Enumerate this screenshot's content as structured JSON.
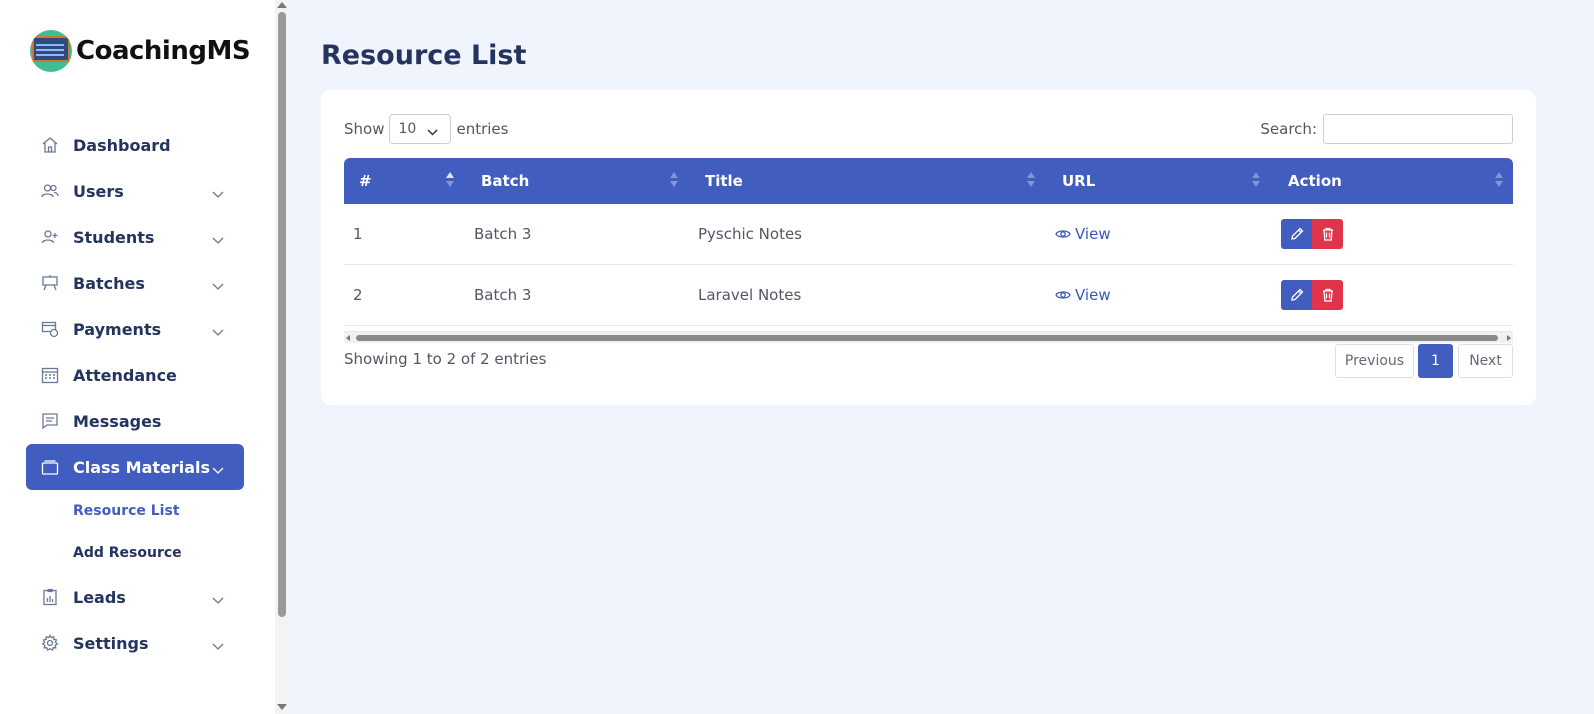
{
  "app": {
    "name": "CoachingMS"
  },
  "sidebar": {
    "items": [
      {
        "label": "Dashboard",
        "icon": "home-icon",
        "has_submenu": false
      },
      {
        "label": "Users",
        "icon": "users-icon",
        "has_submenu": true
      },
      {
        "label": "Students",
        "icon": "user-plus-icon",
        "has_submenu": true
      },
      {
        "label": "Batches",
        "icon": "easel-icon",
        "has_submenu": true
      },
      {
        "label": "Payments",
        "icon": "payment-icon",
        "has_submenu": true
      },
      {
        "label": "Attendance",
        "icon": "calendar-icon",
        "has_submenu": false
      },
      {
        "label": "Messages",
        "icon": "message-icon",
        "has_submenu": false
      },
      {
        "label": "Class Materials",
        "icon": "briefcase-icon",
        "has_submenu": true,
        "active": true
      },
      {
        "label": "Leads",
        "icon": "clipboard-chart-icon",
        "has_submenu": true
      },
      {
        "label": "Settings",
        "icon": "gear-icon",
        "has_submenu": true
      }
    ],
    "submenu": [
      {
        "label": "Resource List",
        "current": true
      },
      {
        "label": "Add Resource",
        "current": false
      }
    ]
  },
  "page": {
    "title": "Resource List"
  },
  "table_controls": {
    "show_label": "Show",
    "entries_value": "10",
    "entries_label": "entries",
    "search_label": "Search:",
    "search_value": ""
  },
  "table": {
    "headers": [
      "#",
      "Batch",
      "Title",
      "URL",
      "Action"
    ],
    "rows": [
      {
        "num": "1",
        "batch": "Batch 3",
        "title": "Pyschic Notes",
        "url_label": "View"
      },
      {
        "num": "2",
        "batch": "Batch 3",
        "title": "Laravel Notes",
        "url_label": "View"
      }
    ]
  },
  "footer": {
    "info": "Showing 1 to 2 of 2 entries",
    "previous": "Previous",
    "page": "1",
    "next": "Next"
  },
  "colors": {
    "accent": "#415dbf",
    "danger": "#e0344a",
    "background": "#f0f5fd",
    "nav_text": "#24345f"
  }
}
